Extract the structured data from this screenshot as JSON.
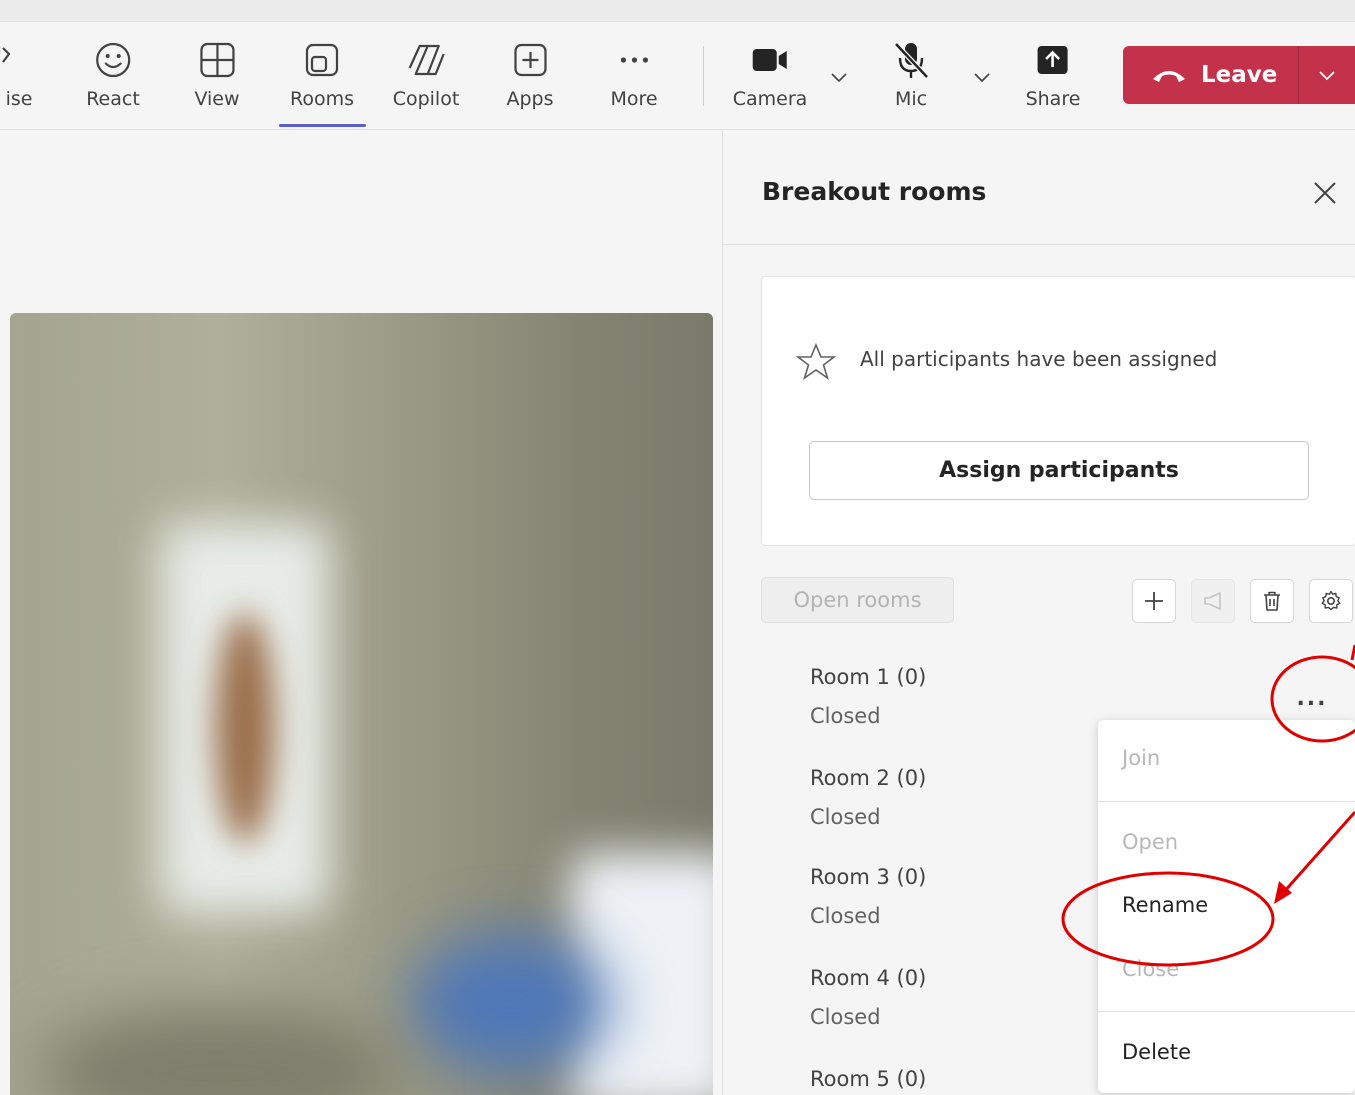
{
  "toolbar": {
    "items": [
      {
        "label": "ise",
        "icon": "raise-hand-icon"
      },
      {
        "label": "React",
        "icon": "smiley-icon"
      },
      {
        "label": "View",
        "icon": "grid-view-icon"
      },
      {
        "label": "Rooms",
        "icon": "rooms-icon",
        "active": true
      },
      {
        "label": "Copilot",
        "icon": "copilot-icon"
      },
      {
        "label": "Apps",
        "icon": "apps-plus-icon"
      },
      {
        "label": "More",
        "icon": "more-dots-icon"
      },
      {
        "label": "Camera",
        "icon": "camera-icon"
      },
      {
        "label": "Mic",
        "icon": "mic-muted-icon"
      },
      {
        "label": "Share",
        "icon": "share-arrow-icon"
      }
    ],
    "leave": {
      "label": "Leave",
      "icon": "hang-up-phone-icon",
      "color": "#c4314b"
    },
    "accent": "#5b5fc7"
  },
  "panel": {
    "title": "Breakout rooms",
    "assigned_message": "All participants have been assigned",
    "assign_button": "Assign participants",
    "open_rooms_button": "Open rooms",
    "actions": [
      "add-icon",
      "announcement-icon",
      "trash-icon",
      "gear-icon"
    ],
    "rooms": [
      {
        "name": "Room 1  (0)",
        "status": "Closed"
      },
      {
        "name": "Room 2  (0)",
        "status": "Closed"
      },
      {
        "name": "Room 3  (0)",
        "status": "Closed"
      },
      {
        "name": "Room 4  (0)",
        "status": "Closed"
      },
      {
        "name": "Room 5  (0)",
        "status": ""
      }
    ],
    "more_button": "...",
    "context_menu": [
      {
        "label": "Join",
        "enabled": false
      },
      {
        "label": "Open",
        "enabled": false
      },
      {
        "label": "Rename",
        "enabled": true
      },
      {
        "label": "Close",
        "enabled": false
      },
      {
        "label": "Delete",
        "enabled": true
      }
    ]
  },
  "annotation_color": "#e00000"
}
